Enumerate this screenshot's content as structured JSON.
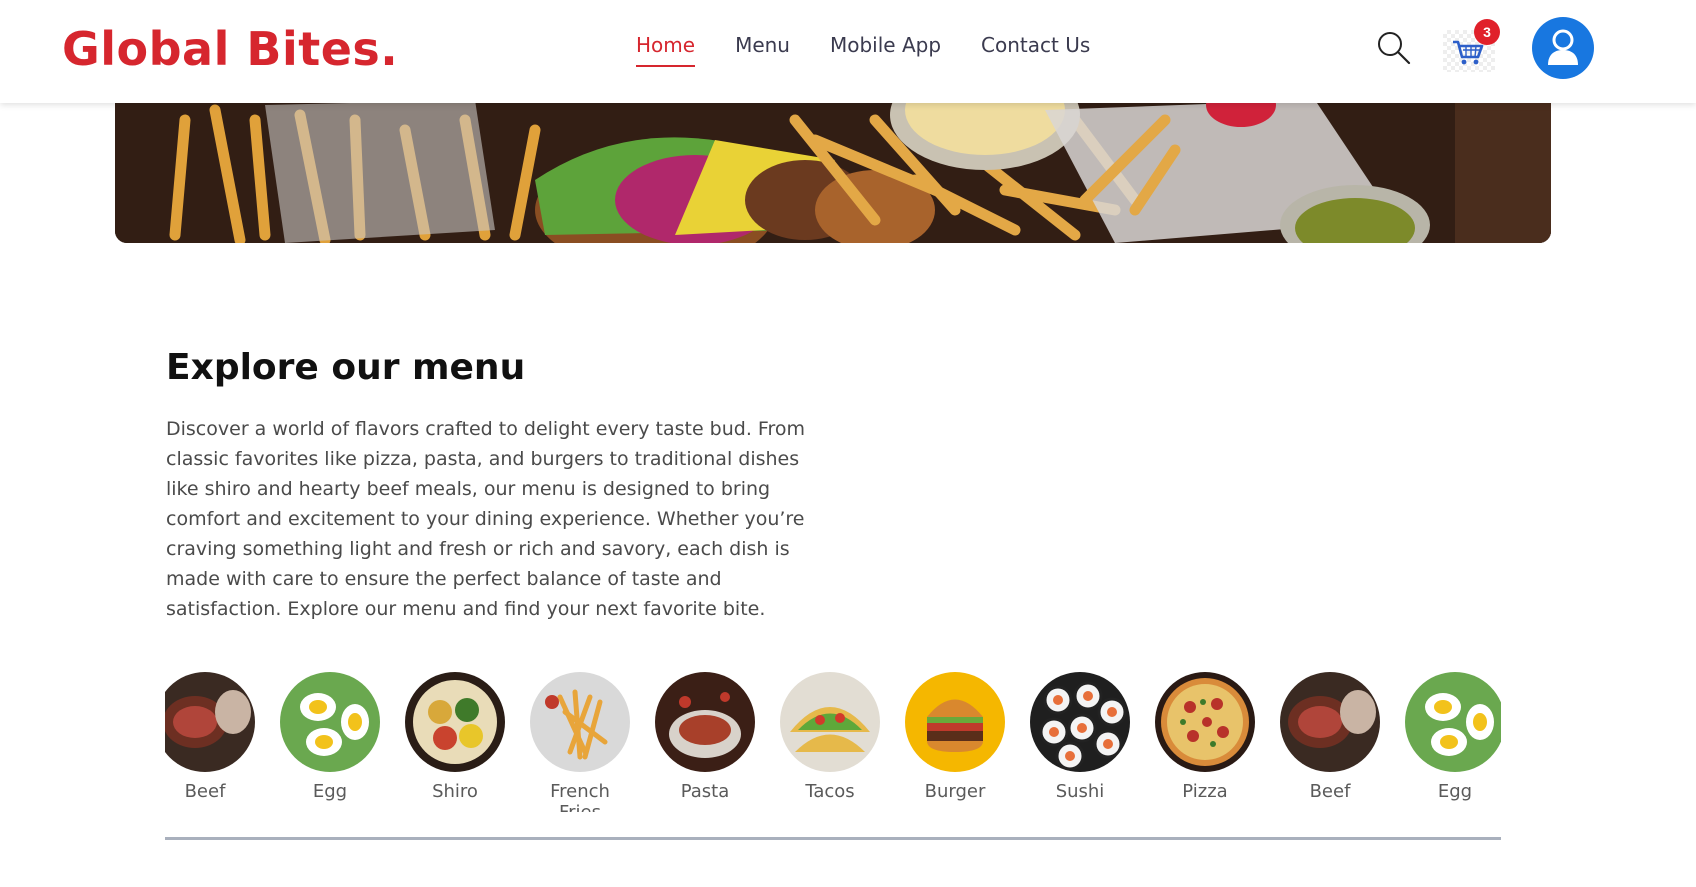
{
  "header": {
    "logo": "Global Bites.",
    "nav": [
      {
        "label": "Home",
        "active": true
      },
      {
        "label": "Menu",
        "active": false
      },
      {
        "label": "Mobile App",
        "active": false
      },
      {
        "label": "Contact Us",
        "active": false
      }
    ],
    "cart_count": "3",
    "icons": {
      "search": "search-icon",
      "cart": "cart-icon",
      "profile": "user-avatar-icon"
    }
  },
  "colors": {
    "brand": "#d6262e",
    "avatar": "#1877e0",
    "badge": "#e0202a"
  },
  "explore": {
    "title": "Explore our menu",
    "description": "Discover a world of flavors crafted to delight every taste bud. From classic favorites like pizza, pasta, and burgers to traditional dishes like shiro and hearty beef meals, our menu is designed to bring comfort and excitement to your dining experience. Whether you’re craving something light and fresh or rich and savory, each dish is made with care to ensure the perfect balance of taste and satisfaction. Explore our menu and find your next favorite bite."
  },
  "menu_items": [
    {
      "label": "Beef"
    },
    {
      "label": "Egg"
    },
    {
      "label": "Shiro"
    },
    {
      "label": "French Fries"
    },
    {
      "label": "Pasta"
    },
    {
      "label": "Tacos"
    },
    {
      "label": "Burger"
    },
    {
      "label": "Sushi"
    },
    {
      "label": "Pizza"
    },
    {
      "label": "Beef"
    },
    {
      "label": "Egg"
    }
  ]
}
